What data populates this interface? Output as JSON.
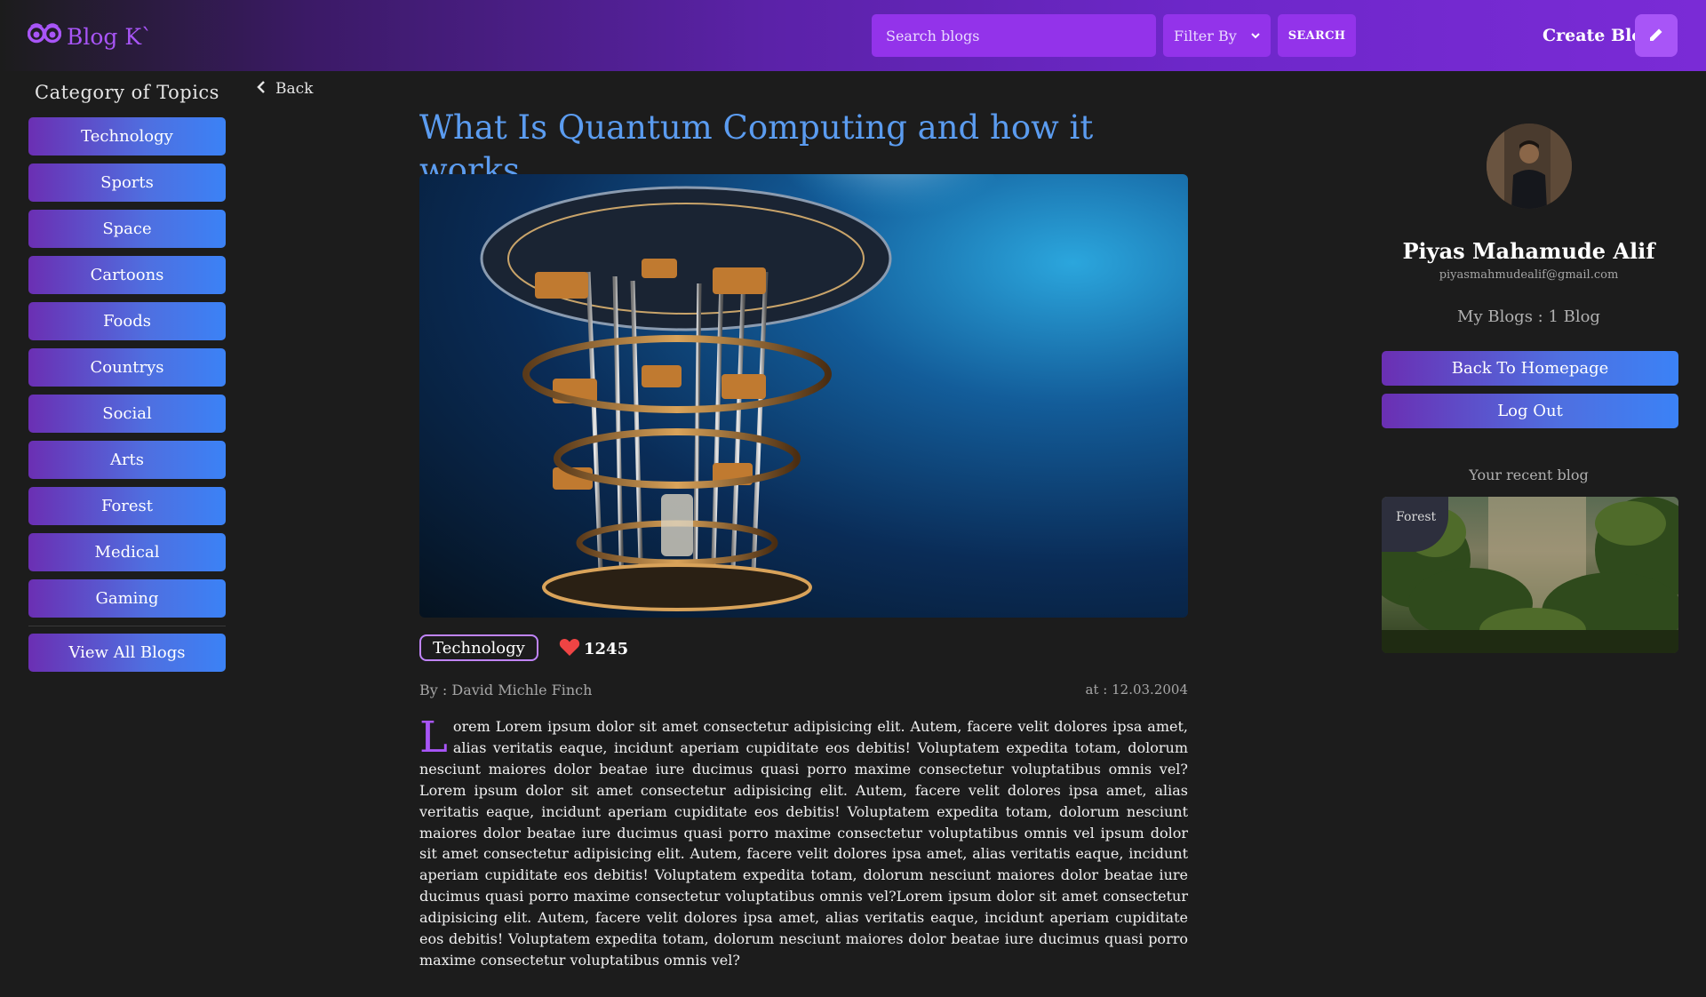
{
  "header": {
    "logo_text": "Blog K`",
    "search_placeholder": "Search blogs",
    "filter_label": "Filter By",
    "search_button": "SEARCH",
    "create_label": "Create Blog",
    "create_icon": "pencil-icon",
    "logo_icon": "owl-glasses-icon"
  },
  "sidebar": {
    "title": "Category of Topics",
    "categories": [
      "Technology",
      "Sports",
      "Space",
      "Cartoons",
      "Foods",
      "Countrys",
      "Social",
      "Arts",
      "Forest",
      "Medical",
      "Gaming"
    ],
    "view_all": "View All Blogs",
    "back_label": "Back"
  },
  "article": {
    "title": "What Is Quantum Computing and how it works.",
    "tag": "Technology",
    "likes": "1245",
    "author": "By : David Michle Finch",
    "date": "at : 12.03.2004",
    "drop_cap": "L",
    "body": "orem Lorem ipsum dolor sit amet consectetur adipisicing elit. Autem, facere velit dolores ipsa amet, alias veritatis eaque, incidunt aperiam cupiditate eos debitis! Voluptatem expedita totam, dolorum nesciunt maiores dolor beatae iure ducimus quasi porro maxime consectetur voluptatibus omnis vel?Lorem ipsum dolor sit amet consectetur adipisicing elit. Autem, facere velit dolores ipsa amet, alias veritatis eaque, incidunt aperiam cupiditate eos debitis! Voluptatem expedita totam, dolorum nesciunt maiores dolor beatae iure ducimus quasi porro maxime consectetur voluptatibus omnis vel ipsum dolor sit amet consectetur adipisicing elit. Autem, facere velit dolores ipsa amet, alias veritatis eaque, incidunt aperiam cupiditate eos debitis! Voluptatem expedita totam, dolorum nesciunt maiores dolor beatae iure ducimus quasi porro maxime consectetur voluptatibus omnis vel?Lorem ipsum dolor sit amet consectetur adipisicing elit. Autem, facere velit dolores ipsa amet, alias veritatis eaque, incidunt aperiam cupiditate eos debitis! Voluptatem expedita totam, dolorum nesciunt maiores dolor beatae iure ducimus quasi porro maxime consectetur voluptatibus omnis vel?"
  },
  "profile": {
    "name": "Piyas Mahamude Alif",
    "email": "piyasmahmudealif@gmail.com",
    "my_blogs": "My Blogs : 1 Blog",
    "back_home": "Back To Homepage",
    "logout": "Log Out",
    "recent_label": "Your recent blog",
    "recent_badge": "Forest"
  },
  "colors": {
    "accent_purple": "#a855f7",
    "title_blue": "#5b9cf0",
    "button_gradient_start": "#6b2fb3",
    "button_gradient_end": "#3b82f6",
    "background": "#1c1c1c",
    "heart": "#ef4444"
  }
}
